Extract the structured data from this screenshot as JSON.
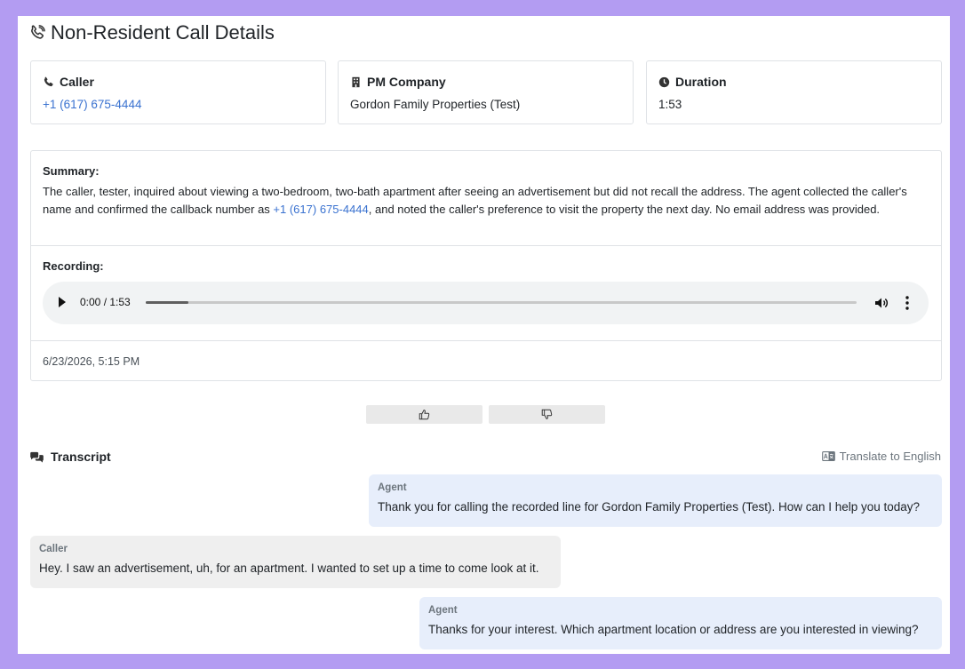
{
  "page": {
    "title": "Non-Resident Call Details"
  },
  "cards": {
    "caller": {
      "label": "Caller",
      "value": "+1 (617) 675-4444"
    },
    "pm_company": {
      "label": "PM Company",
      "value": "Gordon Family Properties (Test)"
    },
    "duration": {
      "label": "Duration",
      "value": "1:53"
    }
  },
  "summary": {
    "label": "Summary:",
    "text_before": "The caller, tester, inquired about viewing a two-bedroom, two-bath apartment after seeing an advertisement but did not recall the address. The agent collected the caller's name and confirmed the callback number as ",
    "phone": "+1 (617) 675-4444",
    "text_after": ", and noted the caller's preference to visit the property the next day. No email address was provided."
  },
  "recording": {
    "label": "Recording:",
    "time_display": "0:00 / 1:53",
    "progress_fraction": 0.06
  },
  "timestamp": "6/23/2026, 5:15 PM",
  "feedback": {
    "thumbs_up_icon": "thumbs-up-icon",
    "thumbs_down_icon": "thumbs-down-icon"
  },
  "transcript": {
    "label": "Transcript",
    "translate_label": "Translate to English",
    "messages": [
      {
        "speaker": "Agent",
        "text": "Thank you for calling the recorded line for Gordon Family Properties (Test). How can I help you today?"
      },
      {
        "speaker": "Caller",
        "text": "Hey. I saw an advertisement, uh, for an apartment. I wanted to set up a time to come look at it."
      },
      {
        "speaker": "Agent",
        "text": "Thanks for your interest. Which apartment location or address are you interested in viewing?"
      }
    ]
  },
  "colors": {
    "background": "#b39cf2",
    "link": "#3a72d0",
    "agent_bubble": "#e7eefb",
    "caller_bubble": "#efefef"
  }
}
